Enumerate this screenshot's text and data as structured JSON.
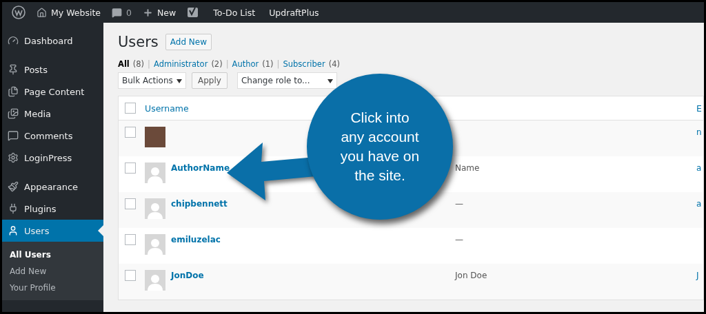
{
  "admin_bar": {
    "items": [
      {
        "kind": "logo"
      },
      {
        "kind": "home",
        "label": "My Website"
      },
      {
        "kind": "comments",
        "label": "0"
      },
      {
        "kind": "new",
        "label": "New"
      },
      {
        "kind": "yoast"
      },
      {
        "kind": "text",
        "label": "To-Do List"
      },
      {
        "kind": "text",
        "label": "UpdraftPlus"
      }
    ]
  },
  "sidebar": {
    "items": [
      {
        "label": "Dashboard",
        "selected": false
      },
      {
        "label": "Posts",
        "selected": false
      },
      {
        "label": "Page Content",
        "selected": false
      },
      {
        "label": "Media",
        "selected": false
      },
      {
        "label": "Comments",
        "selected": false
      },
      {
        "label": "LoginPress",
        "selected": false
      },
      {
        "label": "Appearance",
        "selected": false
      },
      {
        "label": "Plugins",
        "selected": false
      },
      {
        "label": "Users",
        "selected": true
      }
    ],
    "submenu": [
      {
        "label": "All Users",
        "selected": true
      },
      {
        "label": "Add New",
        "selected": false
      },
      {
        "label": "Your Profile",
        "selected": false
      }
    ]
  },
  "page": {
    "title": "Users",
    "add_button": "Add New",
    "filters": [
      {
        "label": "All",
        "count": "(8)",
        "selected": true
      },
      {
        "separator": "|",
        "label": "Administrator",
        "count": "(2)",
        "selected": false
      },
      {
        "separator": "|",
        "label": "Author",
        "count": "(1)",
        "selected": false
      },
      {
        "separator": "|",
        "label": "Subscriber",
        "count": "(4)",
        "selected": false
      }
    ],
    "bulk_actions": "Bulk Actions",
    "apply": "Apply",
    "change_role": "Change role to..."
  },
  "table": {
    "columns": [
      "Username",
      "E"
    ],
    "select_all_checked": false,
    "rows": [
      {
        "photo": true,
        "column_3": "n",
        "checked": false
      },
      {
        "photo": false,
        "username": "AuthorName",
        "name": "Name",
        "column_3": "a",
        "checked": false
      },
      {
        "photo": false,
        "username": "chipbennett",
        "name": "—",
        "column_3": "a",
        "checked": false
      },
      {
        "photo": false,
        "username": "emiluzelac",
        "name": "—",
        "checked": false
      },
      {
        "photo": false,
        "username": "JonDoe",
        "name": "Jon Doe",
        "column_3": "J",
        "checked": false
      }
    ]
  },
  "callout": {
    "text": "Click into\nany account\nyou have on\nthe site."
  }
}
